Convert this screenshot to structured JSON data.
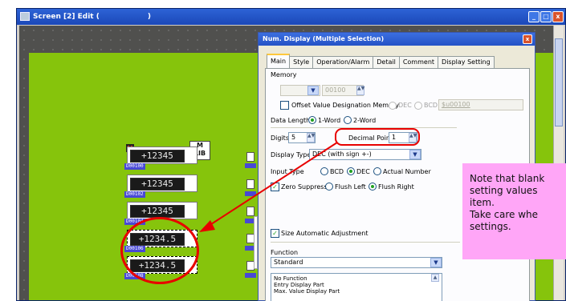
{
  "window": {
    "title": "Screen [2] Edit (",
    "title_close": ")",
    "buttons": [
      "_",
      "□",
      "x"
    ]
  },
  "parts": {
    "rows": [
      {
        "value": "+12345",
        "tag": "D00100"
      },
      {
        "value": "+12345",
        "tag": "D00102"
      },
      {
        "value": "+12345",
        "tag": "D00104"
      },
      {
        "value": "+1234.5",
        "tag": "D00106"
      },
      {
        "value": "+1234.5",
        "tag": "D00108"
      }
    ],
    "badge": "M",
    "mlib": {
      "top": "M",
      "bottom": "LIB"
    }
  },
  "dialog": {
    "title": "Num. Display (Multiple Selection)",
    "close": "x",
    "tabs": [
      "Main",
      "Style",
      "Operation/Alarm",
      "Detail",
      "Comment",
      "Display Setting"
    ],
    "memory_label": "Memory",
    "memory_value": "00100",
    "offset_label": "Offset Value Designation Memory",
    "dec_label": "DEC",
    "bcd_label": "BCD",
    "offset_value": "$u00100",
    "data_length_label": "Data Length",
    "one_word": "1-Word",
    "two_word": "2-Word",
    "digits_label": "Digits",
    "digits_value": "5",
    "decimal_label": "Decimal Point",
    "decimal_value": "1",
    "display_type_label": "Display Type",
    "display_type_value": "DEC (with sign +-)",
    "input_type_label": "Input Type",
    "input_bcd": "BCD",
    "input_dec": "DEC",
    "input_actual": "Actual Number",
    "zero_suppress": "Zero Suppress",
    "flush_left": "Flush Left",
    "flush_right": "Flush Right",
    "size_auto": "Size Automatic Adjustment",
    "function_label": "Function",
    "function_value": "Standard",
    "function_list": [
      "No Function",
      "Entry Display Part",
      "Max. Value Display Part"
    ]
  },
  "note": {
    "lines": [
      "Note that blank",
      "setting values",
      "item.",
      "Take care whe",
      "settings."
    ]
  },
  "colors": {
    "highlight": "#e80000",
    "note_bg": "#ffa6f7",
    "screen_green": "#86c40c",
    "title_blue": "#2552c6"
  },
  "icons": [
    "screen-window-icon",
    "minimize-icon",
    "maximize-icon",
    "close-icon",
    "dropdown-arrow-icon",
    "spin-arrows-icon",
    "checkmark-icon"
  ]
}
